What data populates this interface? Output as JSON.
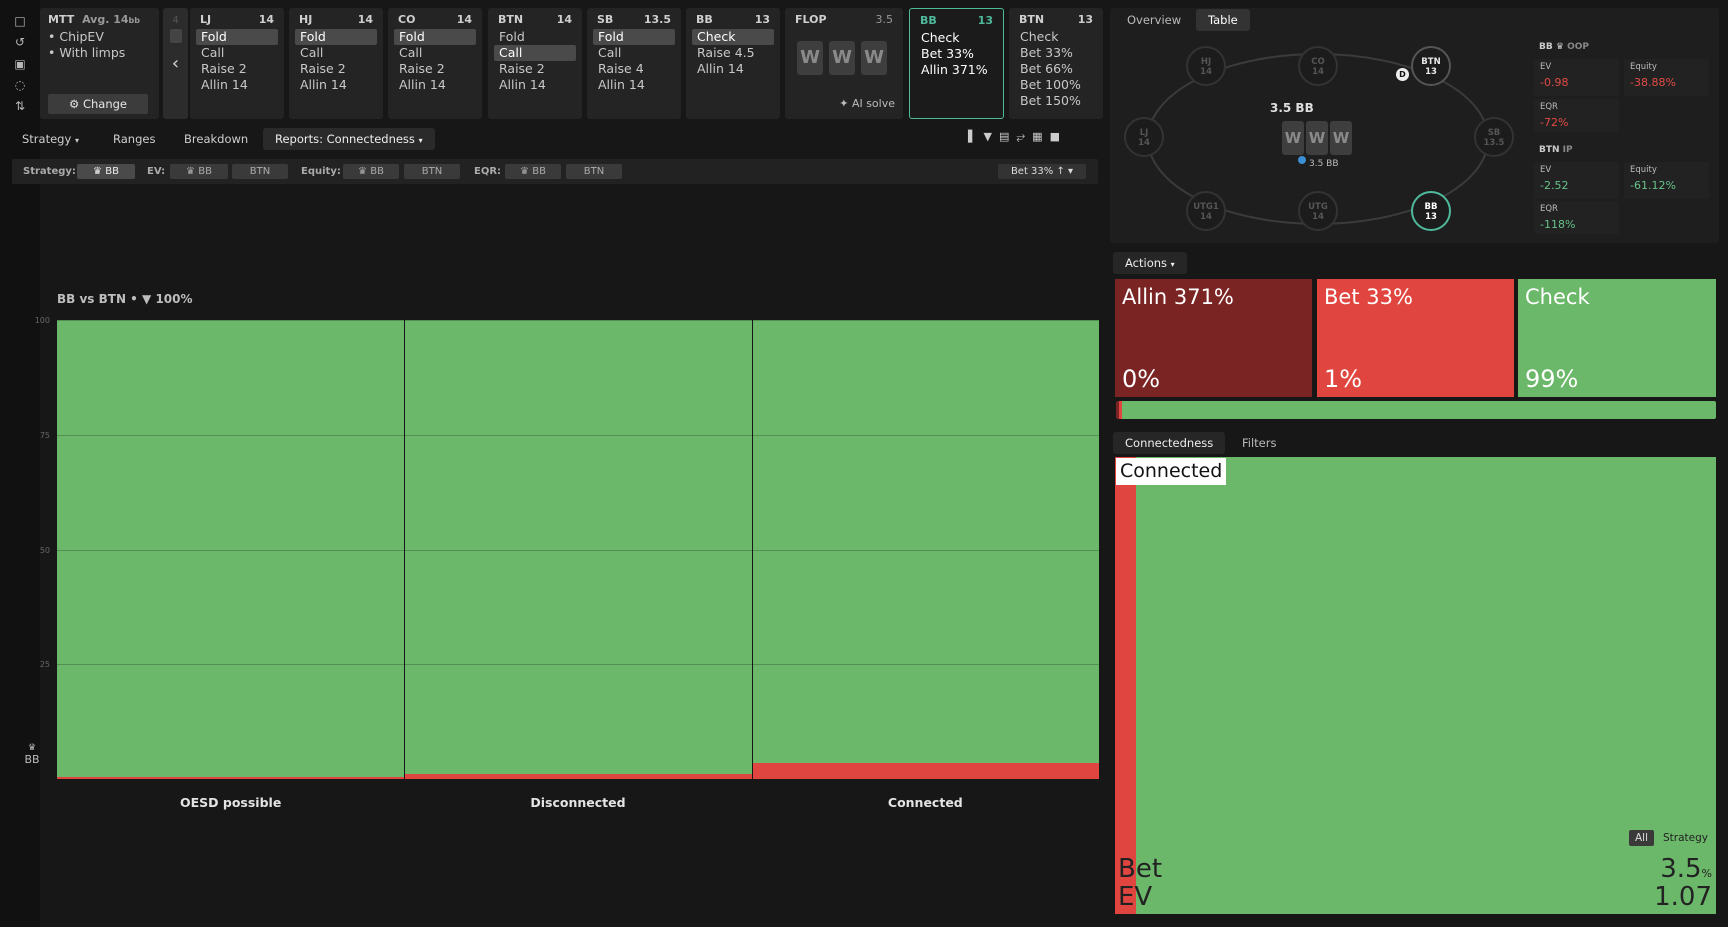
{
  "spot": {
    "game": "MTT",
    "avg_label": "Avg. 14",
    "avg_unit": "bb",
    "options": [
      "ChipEV",
      "With limps"
    ],
    "change": "Change"
  },
  "nav": {
    "prev_count": "4"
  },
  "cards": [
    {
      "pos": "LJ",
      "stack": "14",
      "actions": [
        "Fold",
        "Call",
        "Raise 2",
        "Allin 14"
      ],
      "sel": 0
    },
    {
      "pos": "HJ",
      "stack": "14",
      "actions": [
        "Fold",
        "Call",
        "Raise 2",
        "Allin 14"
      ],
      "sel": 0
    },
    {
      "pos": "CO",
      "stack": "14",
      "actions": [
        "Fold",
        "Call",
        "Raise 2",
        "Allin 14"
      ],
      "sel": 0
    },
    {
      "pos": "BTN",
      "stack": "14",
      "actions": [
        "Fold",
        "Call",
        "Raise 2",
        "Allin 14"
      ],
      "sel": 1
    },
    {
      "pos": "SB",
      "stack": "13.5",
      "actions": [
        "Fold",
        "Call",
        "Raise 4",
        "Allin 14"
      ],
      "sel": 0
    },
    {
      "pos": "BB",
      "stack": "13",
      "actions": [
        "Check",
        "Raise 4.5",
        "Allin 14"
      ],
      "sel": 0
    }
  ],
  "flop": {
    "label": "FLOP",
    "pot": "3.5",
    "cards": [
      "W",
      "W",
      "W"
    ],
    "ai": "AI solve"
  },
  "active": {
    "pos": "BB",
    "stack": "13",
    "actions": [
      "Check",
      "Bet 33%",
      "Allin 371%"
    ]
  },
  "next": {
    "pos": "BTN",
    "stack": "13",
    "actions": [
      "Check",
      "Bet 33%",
      "Bet 66%",
      "Bet 100%",
      "Bet 150%"
    ]
  },
  "tabs": {
    "strategy": "Strategy",
    "ranges": "Ranges",
    "breakdown": "Breakdown",
    "reports": "Reports: Connectedness"
  },
  "filters": {
    "strategy": "Strategy:",
    "ev": "EV:",
    "equity": "Equity:",
    "eqr": "EQR:",
    "bb": "BB",
    "btn": "BTN",
    "bet_sel": "Bet 33%"
  },
  "chart_title": {
    "matchup": "BB vs BTN",
    "filter": "100%"
  },
  "y_axis_label": "BB",
  "chart_data": {
    "type": "bar",
    "stacked": true,
    "categories": [
      "OESD possible",
      "Disconnected",
      "Connected"
    ],
    "series": [
      {
        "name": "Bet 33%",
        "color": "#e0463f",
        "values": [
          0.5,
          1,
          3.5
        ]
      },
      {
        "name": "Check",
        "color": "#6cb86a",
        "values": [
          99.5,
          99,
          96.5
        ]
      }
    ],
    "ylim": [
      0,
      100
    ],
    "yticks": [
      100,
      75,
      50,
      25
    ],
    "grid": true
  },
  "right_tabs": {
    "overview": "Overview",
    "table": "Table"
  },
  "table": {
    "pot": "3.5 BB",
    "board": [
      "W",
      "W",
      "W"
    ],
    "bet": "3.5 BB",
    "dealer": "D",
    "seats": [
      {
        "name": "HJ",
        "stack": "14"
      },
      {
        "name": "CO",
        "stack": "14"
      },
      {
        "name": "BTN",
        "stack": "13"
      },
      {
        "name": "LJ",
        "stack": "14"
      },
      {
        "name": "SB",
        "stack": "13.5"
      },
      {
        "name": "UTG1",
        "stack": "14"
      },
      {
        "name": "UTG",
        "stack": "14"
      },
      {
        "name": "BB",
        "stack": "13"
      }
    ]
  },
  "stats": {
    "bb": {
      "title": "BB",
      "role": "OOP",
      "ev_label": "EV",
      "ev": "0.98",
      "eq_label": "Equity",
      "eq": "38.88%",
      "eqr_label": "EQR",
      "eqr": "72%"
    },
    "btn": {
      "title": "BTN",
      "role": "IP",
      "ev_label": "EV",
      "ev": "2.52",
      "eq_label": "Equity",
      "eq": "61.12%",
      "eqr_label": "EQR",
      "eqr": "118%"
    }
  },
  "actions_panel": {
    "label": "Actions",
    "items": [
      {
        "name": "Allin 371%",
        "pct": "0%",
        "color": "#7a2424"
      },
      {
        "name": "Bet 33%",
        "pct": "1%",
        "color": "#e0463f"
      },
      {
        "name": "Check",
        "pct": "99%",
        "color": "#6cb86a"
      }
    ],
    "freq": [
      0.5,
      0.5,
      99
    ]
  },
  "bottom_tabs": {
    "connectedness": "Connectedness",
    "filters": "Filters"
  },
  "detail": {
    "title": "Connected",
    "all": "All",
    "strategy": "Strategy",
    "bet_label": "Bet",
    "bet_val": "3.5",
    "bet_unit": "%",
    "ev_label": "EV",
    "ev_val": "1.07",
    "bet_freq": 3.5
  }
}
